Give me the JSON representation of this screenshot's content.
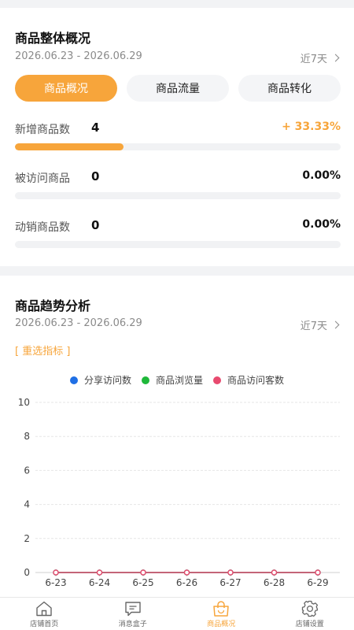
{
  "overview": {
    "title": "商品整体概况",
    "date_range": "2026.06.23 - 2026.06.29",
    "period": "近7天",
    "tabs": [
      {
        "label": "商品概况",
        "active": true
      },
      {
        "label": "商品流量",
        "active": false
      },
      {
        "label": "商品转化",
        "active": false
      }
    ],
    "metrics": [
      {
        "label": "新增商品数",
        "value": "4",
        "change": "+ 33.33%",
        "progress": 0.333
      },
      {
        "label": "被访问商品",
        "value": "0",
        "change": "0.00%",
        "progress": 0
      },
      {
        "label": "动销商品数",
        "value": "0",
        "change": "0.00%",
        "progress": 0
      }
    ]
  },
  "trend": {
    "title": "商品趋势分析",
    "date_range": "2026.06.23 - 2026.06.29",
    "period": "近7天",
    "reselect_label": "[ 重选指标 ]"
  },
  "chart_data": {
    "type": "line",
    "x": [
      "6-23",
      "6-24",
      "6-25",
      "6-26",
      "6-27",
      "6-28",
      "6-29"
    ],
    "ylim": [
      0,
      10
    ],
    "yticks": [
      0,
      2,
      4,
      6,
      8,
      10
    ],
    "grid": true,
    "legend_position": "top-center",
    "series": [
      {
        "name": "分享访问数",
        "color": "#1f6fe5",
        "values": [
          0,
          0,
          0,
          0,
          0,
          0,
          0
        ]
      },
      {
        "name": "商品浏览量",
        "color": "#1fb83a",
        "values": [
          0,
          0,
          0,
          0,
          0,
          0,
          0
        ]
      },
      {
        "name": "商品访问客数",
        "color": "#e84a6f",
        "values": [
          0,
          0,
          0,
          0,
          0,
          0,
          0
        ]
      }
    ]
  },
  "tabbar": {
    "items": [
      {
        "label": "店铺首页",
        "icon": "home-icon",
        "active": false
      },
      {
        "label": "消息盒子",
        "icon": "message-icon",
        "active": false
      },
      {
        "label": "商品概况",
        "icon": "shopping-bag-icon",
        "active": true
      },
      {
        "label": "店铺设置",
        "icon": "gear-icon",
        "active": false
      }
    ]
  },
  "colors": {
    "accent": "#f7a53b",
    "background": "#f2f3f5"
  }
}
